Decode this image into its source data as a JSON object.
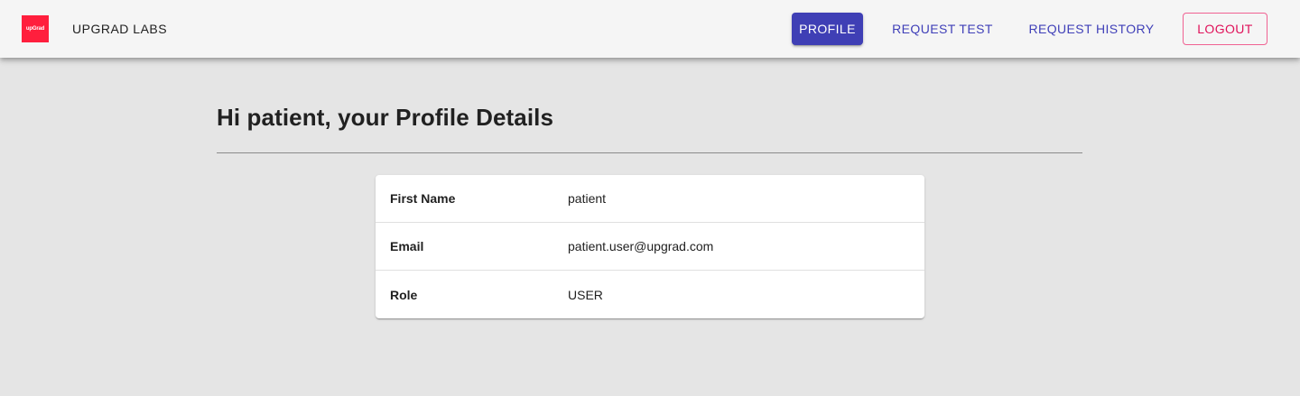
{
  "header": {
    "logo_text": "upGrad",
    "brand": "UPGRAD LABS",
    "nav": {
      "profile": "PROFILE",
      "request_test": "REQUEST TEST",
      "request_history": "REQUEST HISTORY",
      "logout": "LOGOUT"
    }
  },
  "main": {
    "title": "Hi patient, your Profile Details",
    "rows": [
      {
        "label": "First Name",
        "value": "patient"
      },
      {
        "label": "Email",
        "value": "patient.user@upgrad.com"
      },
      {
        "label": "Role",
        "value": "USER"
      }
    ]
  },
  "colors": {
    "brand_red": "#ff1f3d",
    "primary": "#3f3fb5",
    "logout": "#e0125a"
  }
}
